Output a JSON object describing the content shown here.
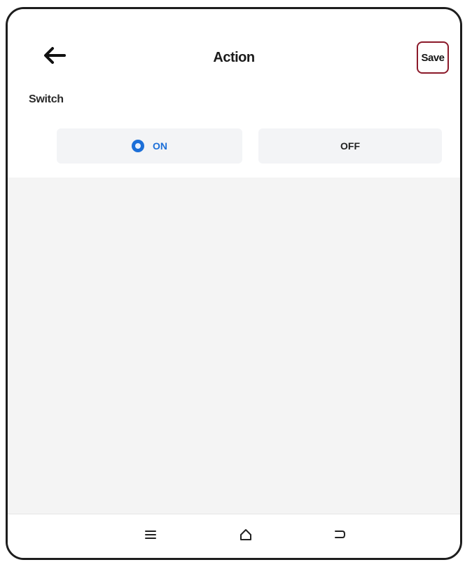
{
  "header": {
    "title": "Action",
    "save_label": "Save",
    "back_icon": "back-arrow-icon"
  },
  "switch": {
    "label": "Switch",
    "options": [
      {
        "label": "ON",
        "selected": true
      },
      {
        "label": "OFF",
        "selected": false
      }
    ],
    "accent_color": "#1c6fd8"
  },
  "navbar": {
    "icons": [
      "menu-icon",
      "home-icon",
      "system-back-icon"
    ]
  },
  "colors": {
    "save_border": "#8b1a2a",
    "selected": "#1c6fd8"
  }
}
